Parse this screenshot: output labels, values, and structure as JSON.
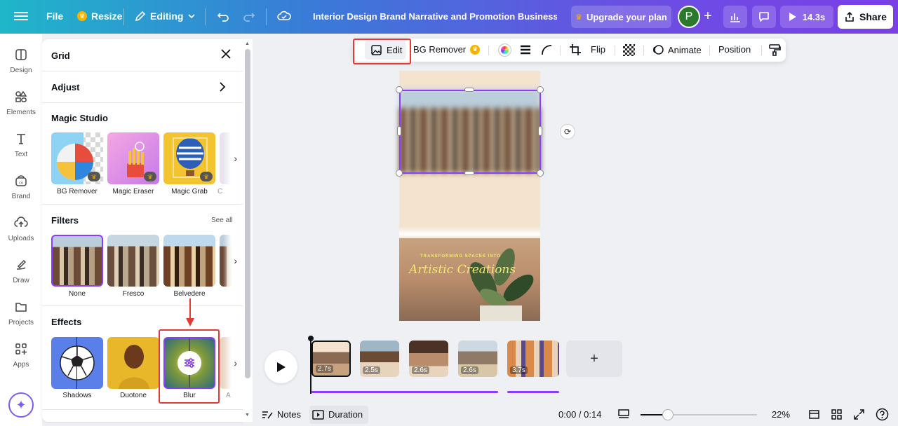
{
  "topbar": {
    "file_label": "File",
    "resize_label": "Resize",
    "editing_label": "Editing",
    "doc_title": "Interior Design Brand Narrative and Promotion  Business In...",
    "upgrade_label": "Upgrade your plan",
    "avatar_initial": "P",
    "play_duration": "14.3s",
    "share_label": "Share"
  },
  "rail": {
    "items": [
      {
        "label": "Design",
        "icon": "design-icon"
      },
      {
        "label": "Elements",
        "icon": "elements-icon"
      },
      {
        "label": "Text",
        "icon": "text-icon"
      },
      {
        "label": "Brand",
        "icon": "brand-icon"
      },
      {
        "label": "Uploads",
        "icon": "uploads-icon"
      },
      {
        "label": "Draw",
        "icon": "draw-icon"
      },
      {
        "label": "Projects",
        "icon": "projects-icon"
      },
      {
        "label": "Apps",
        "icon": "apps-icon"
      }
    ]
  },
  "panel": {
    "title": "Grid",
    "adjust_label": "Adjust",
    "magic_studio": {
      "heading": "Magic Studio",
      "tiles": [
        {
          "label": "BG Remover"
        },
        {
          "label": "Magic Eraser"
        },
        {
          "label": "Magic Grab"
        }
      ],
      "partial_label": "C"
    },
    "filters": {
      "heading": "Filters",
      "see_all": "See all",
      "tiles": [
        {
          "label": "None",
          "selected": true
        },
        {
          "label": "Fresco"
        },
        {
          "label": "Belvedere"
        }
      ]
    },
    "effects": {
      "heading": "Effects",
      "tiles": [
        {
          "label": "Shadows"
        },
        {
          "label": "Duotone"
        },
        {
          "label": "Blur",
          "selected": true
        }
      ],
      "partial_label": "A"
    }
  },
  "floating_toolbar": {
    "edit_label": "Edit",
    "bg_remover_label": "BG Remover",
    "flip_label": "Flip",
    "animate_label": "Animate",
    "position_label": "Position"
  },
  "canvas": {
    "subtitle": "TRANSFORMING SPACES INTO",
    "title": "Artistic Creations"
  },
  "timeline": {
    "clips": [
      {
        "duration": "2.7s",
        "selected": true
      },
      {
        "duration": "2.5s"
      },
      {
        "duration": "2.6s"
      },
      {
        "duration": "2.6s"
      },
      {
        "duration": "3.7s"
      }
    ],
    "add_label": "+"
  },
  "bottombar": {
    "notes_label": "Notes",
    "duration_label": "Duration",
    "time_readout": "0:00 / 0:14",
    "zoom_label": "22%",
    "zoom_fraction": 0.22
  },
  "colors": {
    "accent": "#8b3dff",
    "highlight_box": "#e53935",
    "topbar_gradient_start": "#1fb6c9",
    "topbar_gradient_end": "#7b3fe6"
  }
}
